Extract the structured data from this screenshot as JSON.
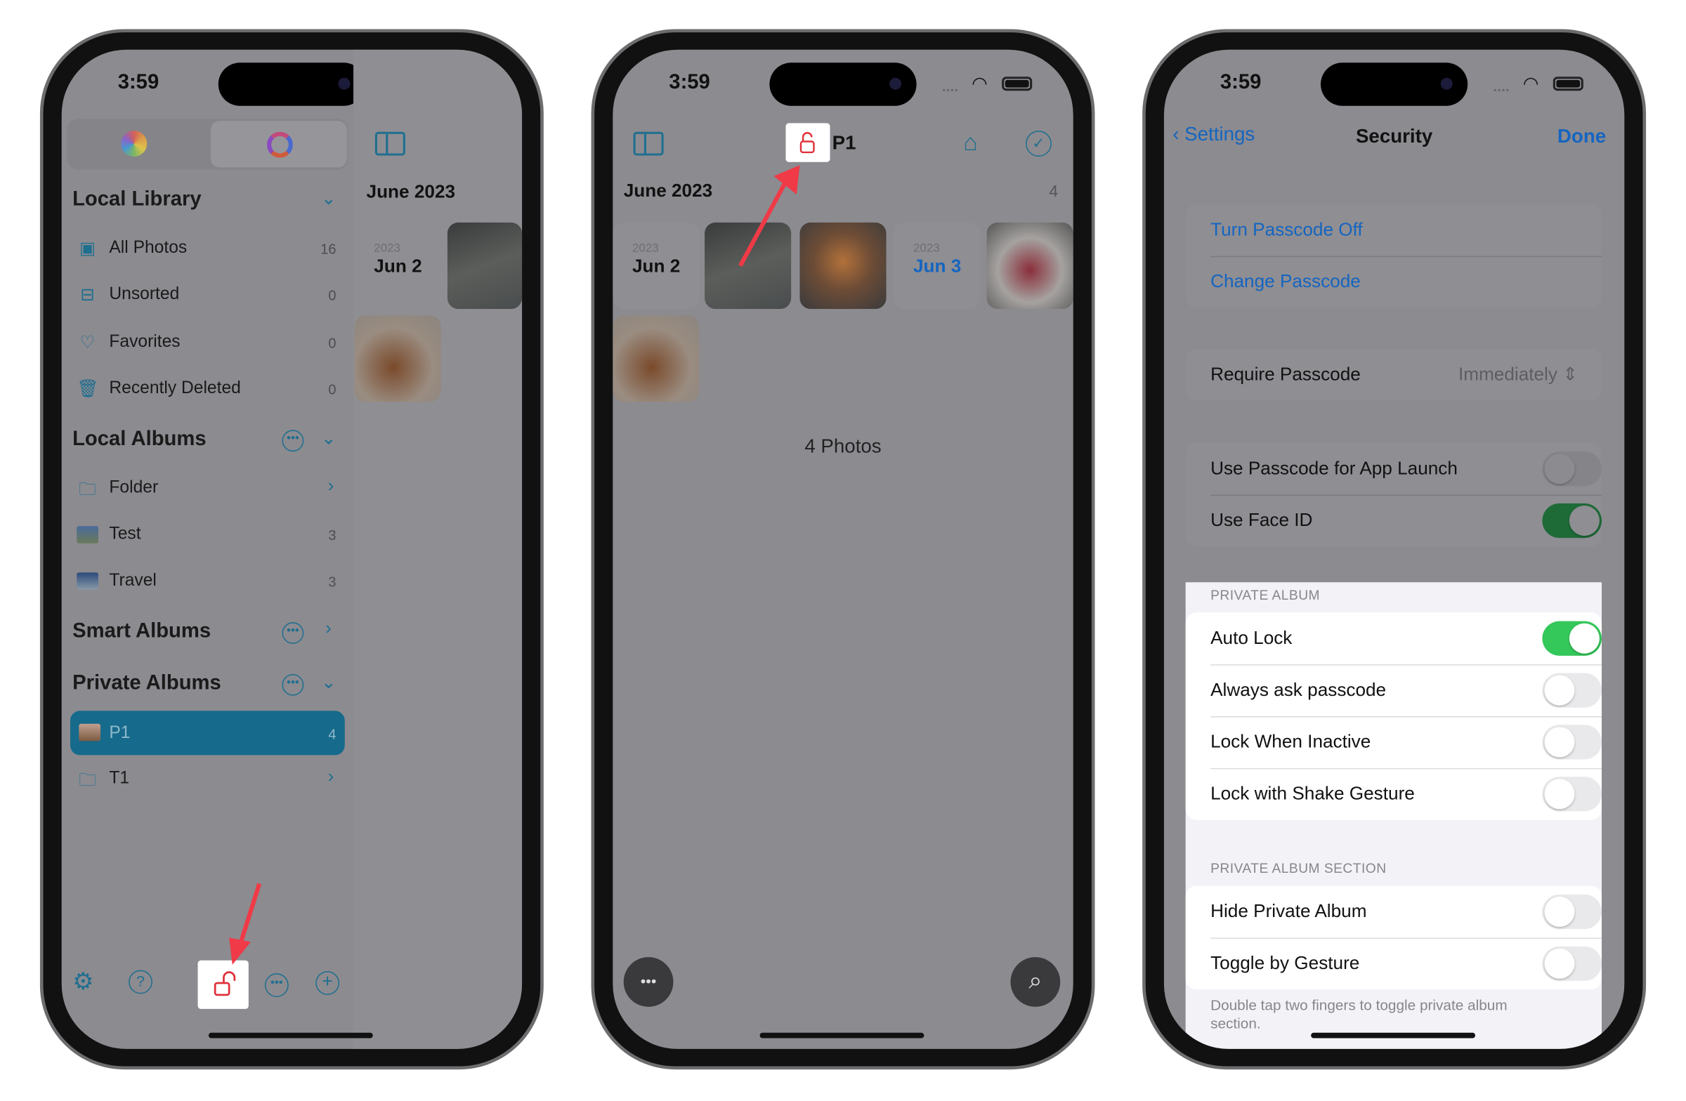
{
  "status": {
    "time": "3:59"
  },
  "colors": {
    "accent": "#1f6f8f",
    "link": "#1565c0",
    "toggle_on": "#34c759",
    "arrow": "#f03a47",
    "lock": "#e0303a"
  },
  "phone1": {
    "segments": [
      {
        "icon": "photos-flower-icon"
      },
      {
        "icon": "color-ring-icon"
      }
    ],
    "sidebar_toggle_icon": "sidebar-icon",
    "local_library": {
      "title": "Local Library",
      "items": [
        {
          "label": "All Photos",
          "count": "16",
          "icon": "photos-icon"
        },
        {
          "label": "Unsorted",
          "count": "0",
          "icon": "tray-icon"
        },
        {
          "label": "Favorites",
          "count": "0",
          "icon": "heart-icon"
        },
        {
          "label": "Recently Deleted",
          "count": "0",
          "icon": "trash-icon"
        }
      ]
    },
    "local_albums": {
      "title": "Local Albums",
      "items": [
        {
          "label": "Folder"
        },
        {
          "label": "Test",
          "count": "3"
        },
        {
          "label": "Travel",
          "count": "3"
        }
      ]
    },
    "smart_albums": {
      "title": "Smart Albums"
    },
    "private_albums": {
      "title": "Private Albums",
      "items": [
        {
          "label": "P1",
          "count": "4",
          "selected": true
        },
        {
          "label": "T1"
        }
      ]
    },
    "detail": {
      "month": "June 2023",
      "year": "2023",
      "day": "Jun 2"
    },
    "toolbar": [
      "gear-icon",
      "help-icon",
      "lock-open-icon",
      "more-icon",
      "add-icon"
    ]
  },
  "phone2": {
    "title": "P1",
    "month": "June 2023",
    "month_count": "4",
    "tiles": [
      {
        "year": "2023",
        "day": "Jun 2"
      },
      {
        "year": "2023",
        "day": "Jun 3"
      }
    ],
    "footer": "4 Photos"
  },
  "phone3": {
    "back": "Settings",
    "title": "Security",
    "done": "Done",
    "passcode": [
      "Turn Passcode Off",
      "Change Passcode"
    ],
    "require": {
      "label": "Require Passcode",
      "value": "Immediately"
    },
    "launch": [
      {
        "label": "Use Passcode for App Launch",
        "on": false
      },
      {
        "label": "Use Face ID",
        "on": true
      }
    ],
    "private_album": {
      "header": "PRIVATE ALBUM",
      "rows": [
        {
          "label": "Auto Lock",
          "on": true
        },
        {
          "label": "Always ask passcode",
          "on": false
        },
        {
          "label": "Lock When Inactive",
          "on": false
        },
        {
          "label": "Lock with Shake Gesture",
          "on": false
        }
      ]
    },
    "private_section": {
      "header": "PRIVATE ALBUM SECTION",
      "rows": [
        {
          "label": "Hide Private Album",
          "on": false
        },
        {
          "label": "Toggle by Gesture",
          "on": false
        }
      ],
      "footer": "Double tap two fingers to toggle private album section."
    }
  }
}
